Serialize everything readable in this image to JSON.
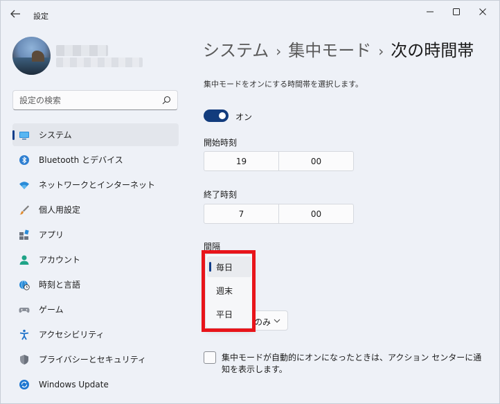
{
  "window": {
    "title": "設定"
  },
  "search": {
    "placeholder": "設定の検索"
  },
  "sidebar": {
    "items": [
      {
        "label": "システム",
        "icon": "monitor-icon"
      },
      {
        "label": "Bluetooth とデバイス",
        "icon": "bluetooth-icon"
      },
      {
        "label": "ネットワークとインターネット",
        "icon": "wifi-icon"
      },
      {
        "label": "個人用設定",
        "icon": "paintbrush-icon"
      },
      {
        "label": "アプリ",
        "icon": "apps-icon"
      },
      {
        "label": "アカウント",
        "icon": "person-icon"
      },
      {
        "label": "時刻と言語",
        "icon": "globe-clock-icon"
      },
      {
        "label": "ゲーム",
        "icon": "gamepad-icon"
      },
      {
        "label": "アクセシビリティ",
        "icon": "accessibility-icon"
      },
      {
        "label": "プライバシーとセキュリティ",
        "icon": "shield-icon"
      },
      {
        "label": "Windows Update",
        "icon": "update-icon"
      }
    ],
    "active_index": 0
  },
  "breadcrumb": {
    "level1": "システム",
    "level2": "集中モード",
    "level3": "次の時間帯",
    "separator": "›"
  },
  "main": {
    "description": "集中モードをオンにする時間帯を選択します。",
    "toggle": {
      "state": "on",
      "label": "オン"
    },
    "start_time": {
      "label": "開始時刻",
      "hour": "19",
      "minute": "00"
    },
    "end_time": {
      "label": "終了時刻",
      "hour": "7",
      "minute": "00"
    },
    "repeat": {
      "label": "間隔",
      "selected_text_visible": "のみ",
      "options": [
        "毎日",
        "週末",
        "平日"
      ],
      "selected_option": "毎日"
    },
    "notify_checkbox": {
      "checked": false,
      "label": "集中モードが自動的にオンになったときは、アクション センターに通知を表示します。"
    }
  },
  "colors": {
    "accent": "#123c7d",
    "highlight_border": "#e8141a",
    "background": "#eef1f7"
  }
}
